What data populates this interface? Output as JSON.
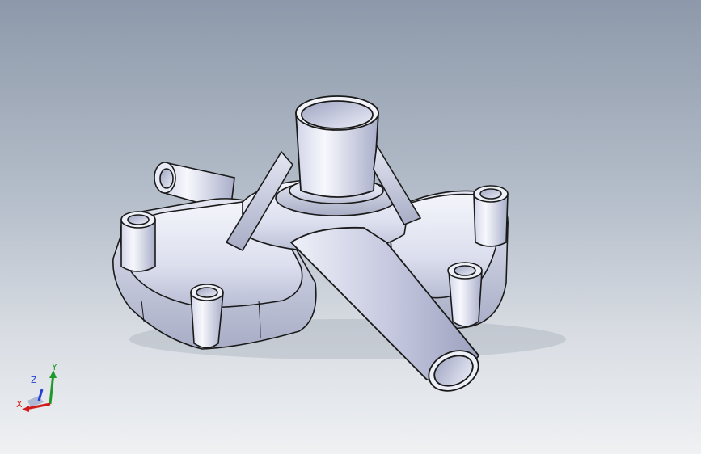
{
  "triad": {
    "x_label": "X",
    "y_label": "Y",
    "z_label": "Z",
    "x_color": "#d11a1a",
    "y_color": "#1f9a2a",
    "z_color": "#1f3fd6"
  },
  "model": {
    "part_icon": "pump-housing-3d-part"
  }
}
